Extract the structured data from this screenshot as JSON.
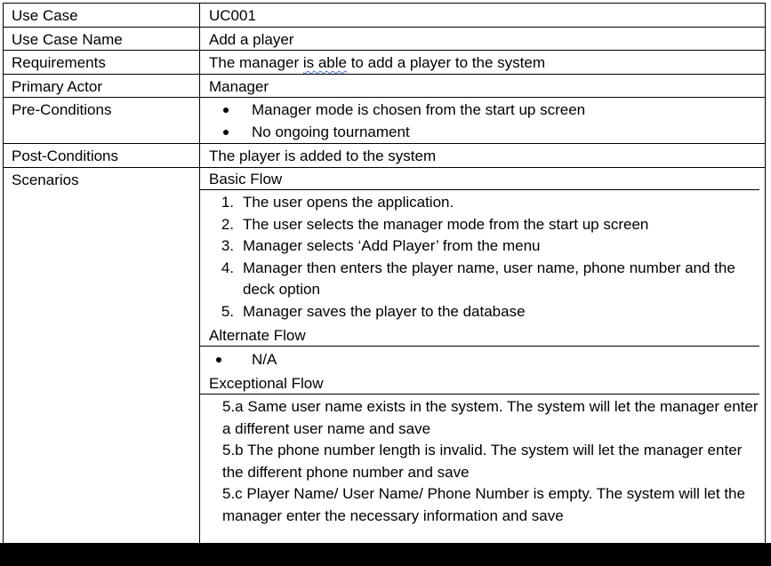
{
  "rows": {
    "use_case": {
      "label": "Use Case",
      "value": "UC001"
    },
    "use_case_name": {
      "label": "Use Case Name",
      "value": "Add a player"
    },
    "requirements": {
      "label": "Requirements",
      "value_pre": "The manager ",
      "value_squiggle": "is able",
      "value_post": " to add a player to the system"
    },
    "primary_actor": {
      "label": "Primary Actor",
      "value": "Manager"
    },
    "pre_conditions": {
      "label": "Pre-Conditions",
      "items": [
        "Manager mode is chosen from the start up screen",
        "No ongoing tournament"
      ]
    },
    "post_conditions": {
      "label": "Post-Conditions",
      "value": "The player is added to the system"
    },
    "scenarios": {
      "label": "Scenarios",
      "basic_flow": {
        "title": "Basic Flow",
        "steps": [
          {
            "num": "1.",
            "text": "The user opens the application."
          },
          {
            "num": "2.",
            "text": "The user selects the manager mode from the start up screen"
          },
          {
            "num": "3.",
            "text": "Manager selects ‘Add Player’ from the menu"
          },
          {
            "num": "4.",
            "text": "Manager then enters the player name, user name, phone number and the deck option"
          },
          {
            "num": "5.",
            "text": "Manager saves the player to the database"
          }
        ]
      },
      "alternate_flow": {
        "title": "Alternate Flow",
        "items": [
          "N/A"
        ]
      },
      "exceptional_flow": {
        "title": "Exceptional Flow",
        "items": [
          "5.a Same user name exists in the system. The system will let the manager enter a different user name and save",
          "5.b The phone number length is invalid. The system will let the manager enter the different phone number and save",
          "5.c Player Name/ User Name/ Phone Number is empty. The system will let the manager enter the necessary information and save"
        ]
      }
    }
  }
}
